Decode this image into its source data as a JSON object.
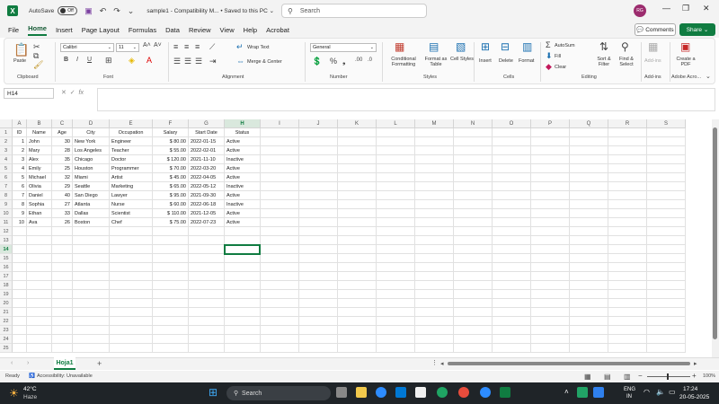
{
  "titlebar": {
    "autosave_label": "AutoSave",
    "autosave_state": "Off",
    "doc_title": "sample1  -  Compatibility M...  •  Saved to this PC ⌄",
    "search_placeholder": "Search",
    "avatar_initials": "RG"
  },
  "menu": [
    "File",
    "Home",
    "Insert",
    "Page Layout",
    "Formulas",
    "Data",
    "Review",
    "View",
    "Help",
    "Acrobat"
  ],
  "comments_label": "Comments",
  "share_label": "Share",
  "ribbon": {
    "paste": "Paste",
    "clipboard": "Clipboard",
    "font_name": "Calibri",
    "font_size": "11",
    "font": "Font",
    "wrap_text": "Wrap Text",
    "merge_center": "Merge & Center",
    "alignment": "Alignment",
    "number_format": "General",
    "number": "Number",
    "conditional_formatting": "Conditional Formatting",
    "format_as_table": "Format as Table",
    "cell_styles": "Cell Styles",
    "styles": "Styles",
    "insert": "Insert",
    "delete": "Delete",
    "format": "Format",
    "cells": "Cells",
    "autosum": "AutoSum",
    "fill": "Fill",
    "clear": "Clear",
    "sort_filter": "Sort & Filter",
    "find_select": "Find & Select",
    "editing": "Editing",
    "addins": "Add-ins",
    "addins_group": "Add-ins",
    "create_pdf": "Create a PDF",
    "adobe_acrobat": "Adobe Acro..."
  },
  "namebox": "H14",
  "columns": [
    "A",
    "B",
    "C",
    "D",
    "E",
    "F",
    "G",
    "H",
    "I",
    "J",
    "K",
    "L",
    "M",
    "N",
    "O",
    "P",
    "Q",
    "R",
    "S"
  ],
  "headers": [
    "ID",
    "Name",
    "Age",
    "City",
    "Occupation",
    "Salary",
    "Start Date",
    "Status"
  ],
  "rows": [
    [
      "1",
      "John",
      "30",
      "New York",
      "Engineer",
      "$ 80.00",
      "2022-01-15",
      "Active"
    ],
    [
      "2",
      "Mary",
      "28",
      "Los Angeles",
      "Teacher",
      "$ 55.00",
      "2022-02-01",
      "Active"
    ],
    [
      "3",
      "Alex",
      "35",
      "Chicago",
      "Doctor",
      "$ 120.00",
      "2021-11-10",
      "Inactive"
    ],
    [
      "4",
      "Emily",
      "25",
      "Houston",
      "Programmer",
      "$ 70.00",
      "2022-03-20",
      "Active"
    ],
    [
      "5",
      "Michael",
      "32",
      "Miami",
      "Artist",
      "$ 45.00",
      "2022-04-05",
      "Active"
    ],
    [
      "6",
      "Olivia",
      "29",
      "Seattle",
      "Marketing",
      "$ 65.00",
      "2022-05-12",
      "Inactive"
    ],
    [
      "7",
      "Daniel",
      "40",
      "San Diego",
      "Lawyer",
      "$ 95.00",
      "2021-09-30",
      "Active"
    ],
    [
      "8",
      "Sophia",
      "27",
      "Atlanta",
      "Nurse",
      "$ 60.00",
      "2022-06-18",
      "Inactive"
    ],
    [
      "9",
      "Ethan",
      "33",
      "Dallas",
      "Scientist",
      "$ 110.00",
      "2021-12-05",
      "Active"
    ],
    [
      "10",
      "Ava",
      "26",
      "Boston",
      "Chef",
      "$ 75.00",
      "2022-07-23",
      "Active"
    ]
  ],
  "row_numbers": [
    "1",
    "2",
    "3",
    "4",
    "5",
    "6",
    "7",
    "8",
    "9",
    "10",
    "11",
    "12",
    "13",
    "14",
    "15",
    "16",
    "17",
    "18",
    "19",
    "20",
    "21",
    "22",
    "23",
    "24",
    "25"
  ],
  "sheet_tab": "Hoja1",
  "status": {
    "ready": "Ready",
    "accessibility": "Accessibility: Unavailable",
    "zoom": "100%"
  },
  "taskbar": {
    "weather_temp": "42°C",
    "weather_desc": "Haze",
    "search": "Search",
    "lang1": "ENG",
    "lang2": "IN",
    "time": "17:24",
    "date": "20-05-2025"
  }
}
